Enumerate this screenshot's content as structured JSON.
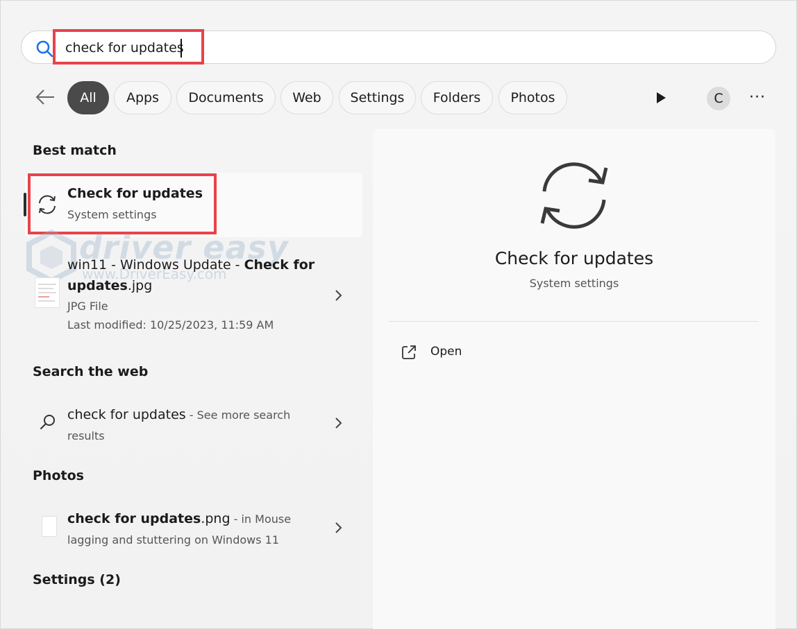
{
  "search": {
    "value": "check for updates"
  },
  "filters": [
    {
      "label": "All",
      "active": true
    },
    {
      "label": "Apps"
    },
    {
      "label": "Documents"
    },
    {
      "label": "Web"
    },
    {
      "label": "Settings"
    },
    {
      "label": "Folders"
    },
    {
      "label": "Photos"
    }
  ],
  "toolbar": {
    "avatar_letter": "C",
    "more_label": "···"
  },
  "best_match": {
    "section": "Best match",
    "title": "Check for updates",
    "subtitle": "System settings"
  },
  "watermark": {
    "text": "driver easy",
    "url": "www.DriverEasy.com"
  },
  "file_result": {
    "title_part1": "win11 - Windows Update - ",
    "title_bold": "Check for",
    "title_line2_bold": "updates",
    "title_line2_rest": ".jpg",
    "type": "JPG File",
    "modified": "Last modified: 10/25/2023, 11:59 AM"
  },
  "web": {
    "section": "Search the web",
    "query": "check for updates",
    "suffix": " - See more search",
    "suffix_line2": "results"
  },
  "photos": {
    "section": "Photos",
    "title_bold": "check for updates",
    "title_rest": ".png",
    "location": " - in Mouse",
    "location_line2": "lagging and stuttering on Windows 11"
  },
  "settings": {
    "section": "Settings (2)"
  },
  "detail": {
    "title": "Check for updates",
    "subtitle": "System settings",
    "open_label": "Open"
  },
  "colors": {
    "highlight": "#e8424a",
    "active_chip": "#4a4a4a",
    "search_icon": "#1a73e8"
  }
}
